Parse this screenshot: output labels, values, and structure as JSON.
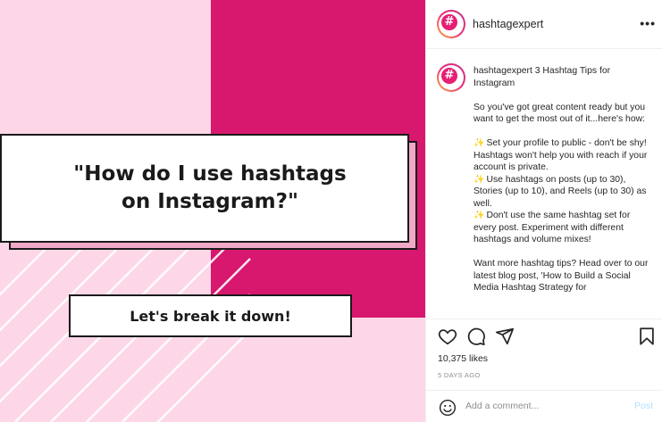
{
  "post_image": {
    "headline": "\"How do I use hashtags on Instagram?\"",
    "cta": "Let's break it down!",
    "colors": {
      "pink_light": "#fdd7e8",
      "magenta": "#d8176f",
      "shadow_pink": "#f0a8c7"
    }
  },
  "header": {
    "username": "hashtagexpert",
    "avatar_icon": "hashtag-logo-icon",
    "more_icon": "more-options-icon"
  },
  "caption": {
    "username": "hashtagexpert",
    "title": "3 Hashtag Tips for Instagram",
    "intro": "So you've got great content ready but you want to get the most out of it...here's how:",
    "tips": [
      "Set your profile to public - don't be shy! Hashtags won't help you with reach if your account is private.",
      "Use hashtags on posts (up to 30), Stories (up to 10), and Reels (up to 30) as well.",
      "Don't use the same hashtag set for every post. Experiment with different hashtags and volume mixes!"
    ],
    "outro": "Want more hashtag tips? Head over to our latest blog post, 'How to Build a Social Media Hashtag Strategy for"
  },
  "actions": {
    "like_icon": "heart-icon",
    "comment_icon": "comment-icon",
    "share_icon": "share-icon",
    "save_icon": "bookmark-icon"
  },
  "likes": "10,375 likes",
  "timestamp": "5 DAYS AGO",
  "comment": {
    "placeholder": "Add a comment...",
    "post_label": "Post"
  },
  "accent_colors": {
    "post_button_disabled": "#b2dffc",
    "brand": "#e61e74"
  }
}
